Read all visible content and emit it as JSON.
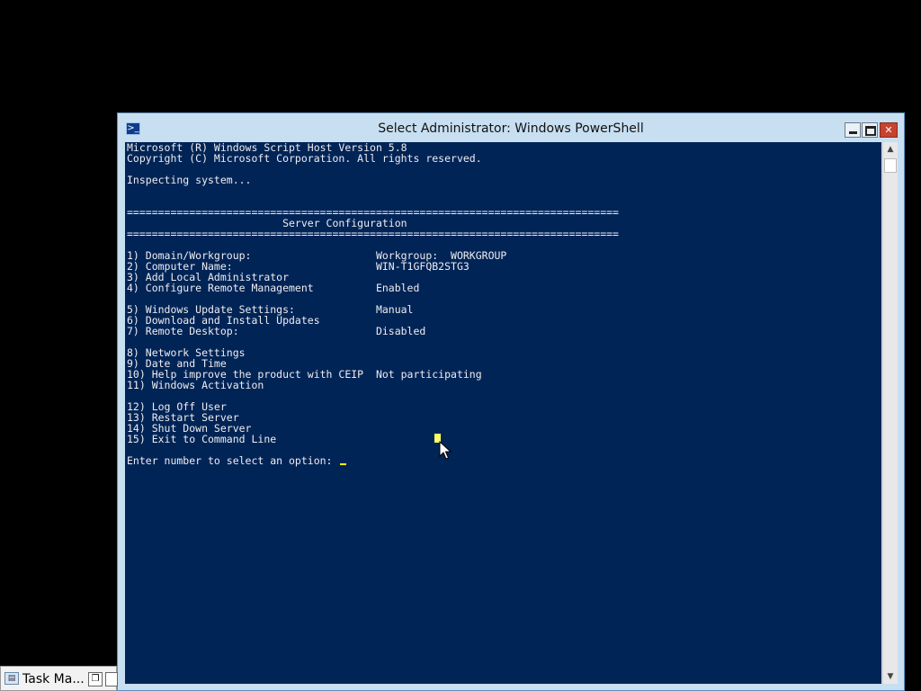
{
  "window": {
    "title": "Select Administrator: Windows PowerShell",
    "icon": "powershell-icon"
  },
  "console": {
    "lines": [
      "Microsoft (R) Windows Script Host Version 5.8",
      "Copyright (C) Microsoft Corporation. All rights reserved.",
      "",
      "Inspecting system...",
      "",
      "",
      "===============================================================================",
      "                         Server Configuration",
      "===============================================================================",
      "",
      "1) Domain/Workgroup:                    Workgroup:  WORKGROUP",
      "2) Computer Name:                       WIN-T1GFQB2STG3",
      "3) Add Local Administrator",
      "4) Configure Remote Management          Enabled",
      "",
      "5) Windows Update Settings:             Manual",
      "6) Download and Install Updates",
      "7) Remote Desktop:                      Disabled",
      "",
      "8) Network Settings",
      "9) Date and Time",
      "10) Help improve the product with CEIP  Not participating",
      "11) Windows Activation",
      "",
      "12) Log Off User",
      "13) Restart Server",
      "14) Shut Down Server",
      "15) Exit to Command Line",
      ""
    ],
    "prompt": "Enter number to select an option: ",
    "colors": {
      "background": "#012456",
      "foreground": "#eeedf0",
      "cursor": "#ffff00"
    }
  },
  "taskbar": {
    "item_label": "Task Ma...",
    "item_icon": "task-manager-icon"
  }
}
